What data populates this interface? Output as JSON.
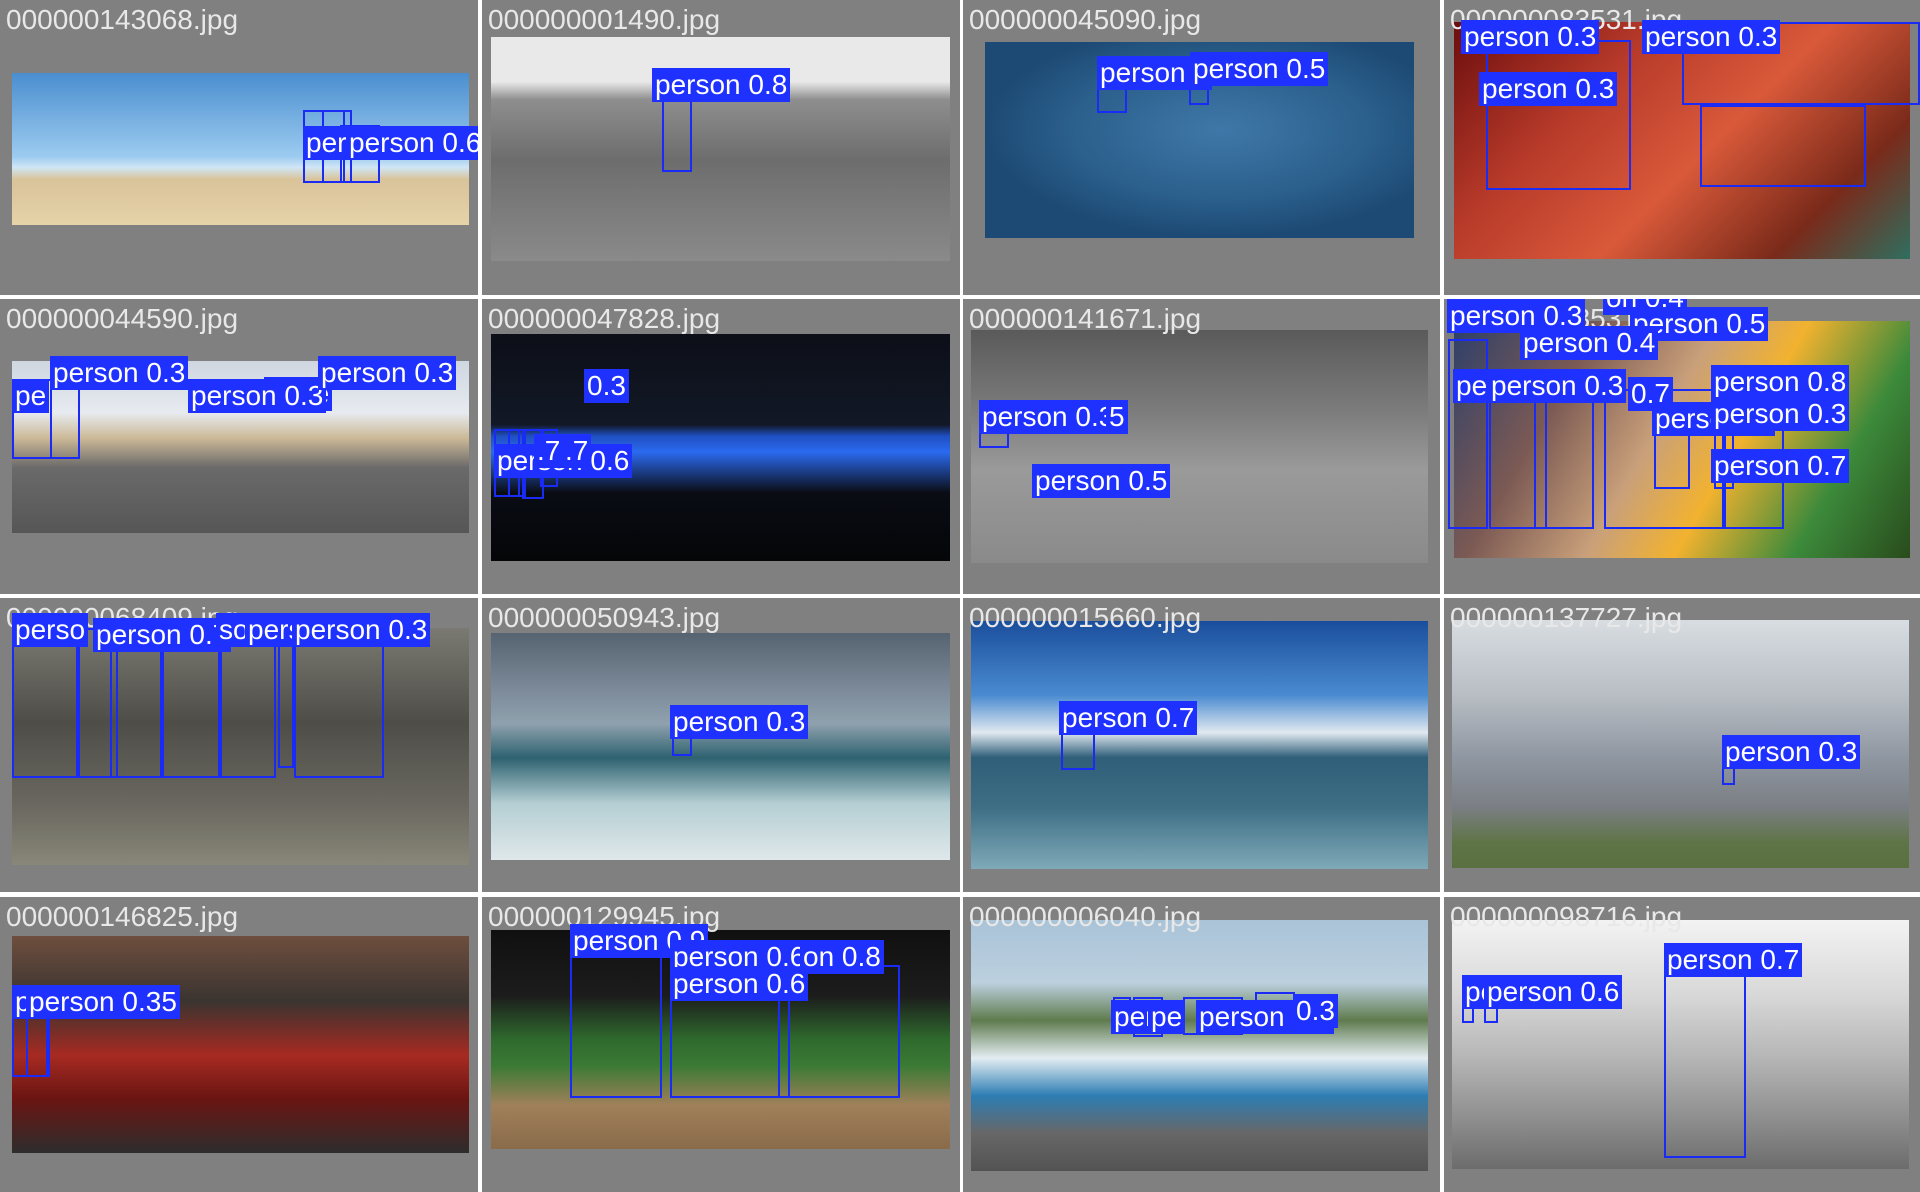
{
  "colors": {
    "background": "#808080",
    "box": "#1a2bf5",
    "label_bg": "#1f31ff",
    "label_text": "#ffffff",
    "filename": "#e8e8e8"
  },
  "tiles": [
    {
      "filename": "000000143068.jpg",
      "labels": [
        "perso",
        "person 0.6"
      ]
    },
    {
      "filename": "000000001490.jpg",
      "labels": [
        "person 0.8"
      ]
    },
    {
      "filename": "000000045090.jpg",
      "labels": [
        "person 0",
        "person 0.5"
      ]
    },
    {
      "filename": "000000083531.jpg",
      "labels": [
        "person 0.3",
        "person 0.3",
        "person 0.3"
      ]
    },
    {
      "filename": "000000044590.jpg",
      "labels": [
        "pe",
        "person 0.3",
        "pe",
        "pe",
        "person 0.3",
        "person 0.3"
      ]
    },
    {
      "filename": "000000047828.jpg",
      "labels": [
        "person 0.6",
        ".7",
        ".7",
        "0.3"
      ]
    },
    {
      "filename": "000000141671.jpg",
      "labels": [
        "person 0.3",
        "5",
        "person 0.5"
      ]
    },
    {
      "filename": "000000083531.jpg",
      "labels": [
        "person 0.3",
        "on 0.4",
        "person 0.5",
        "person 0.4",
        "pe",
        "person 0.3",
        "0.7",
        "person 0.",
        "person 0.8",
        "person 0.3",
        "person 0.7"
      ]
    },
    {
      "filename": "000000068409.jpg",
      "labels": [
        "perso",
        "person 0.7",
        "so",
        "perso",
        "person 0.3",
        "9"
      ]
    },
    {
      "filename": "000000050943.jpg",
      "labels": [
        "person 0.3"
      ]
    },
    {
      "filename": "000000015660.jpg",
      "labels": [
        "person 0.7"
      ]
    },
    {
      "filename": "000000137727.jpg",
      "labels": [
        "person 0.3"
      ]
    },
    {
      "filename": "000000146825.jpg",
      "labels": [
        "p",
        "person 0.35"
      ]
    },
    {
      "filename": "000000129945.jpg",
      "labels": [
        "person 0.9",
        "person 0.6",
        "on 0.8",
        "person 0.6"
      ]
    },
    {
      "filename": "000000006040.jpg",
      "labels": [
        "pers",
        "pe",
        "person 0.3",
        "0.3"
      ]
    },
    {
      "filename": "000000098716.jpg",
      "labels": [
        "pe",
        "person 0.6",
        "person 0.7"
      ]
    }
  ]
}
